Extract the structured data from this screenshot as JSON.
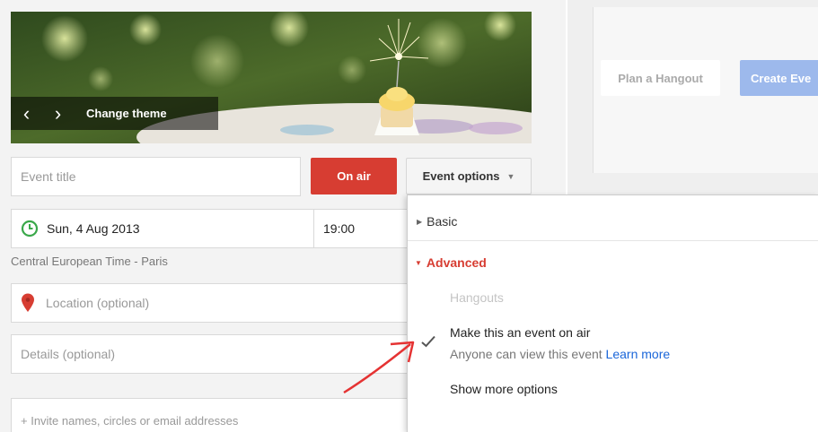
{
  "theme": {
    "prev_glyph": "‹",
    "next_glyph": "›",
    "change_label": "Change theme"
  },
  "form": {
    "title_placeholder": "Event title",
    "on_air_label": "On air",
    "event_options_label": "Event options",
    "date_value": "Sun, 4 Aug 2013",
    "time_value": "19:00",
    "timezone": "Central European Time - Paris",
    "location_placeholder": "Location (optional)",
    "details_placeholder": "Details (optional)",
    "invite_placeholder": "+ Invite names, circles or email addresses"
  },
  "right": {
    "plan_hangout_label": "Plan a Hangout",
    "create_event_label": "Create Eve"
  },
  "dropdown": {
    "basic_label": "Basic",
    "advanced_label": "Advanced",
    "hangouts_label": "Hangouts",
    "on_air_title": "Make this an event on air",
    "on_air_sub": "Anyone can view this event",
    "learn_more": "Learn more",
    "show_more": "Show more options"
  },
  "icons": {
    "clock": "clock-icon",
    "pin": "location-pin-icon",
    "check": "checkmark-icon",
    "caret": "caret-down-icon"
  },
  "colors": {
    "on_air_red": "#d73d32",
    "link_blue": "#1a66d9",
    "clock_green": "#3aa84a",
    "create_button_blue": "#9db9ec"
  }
}
